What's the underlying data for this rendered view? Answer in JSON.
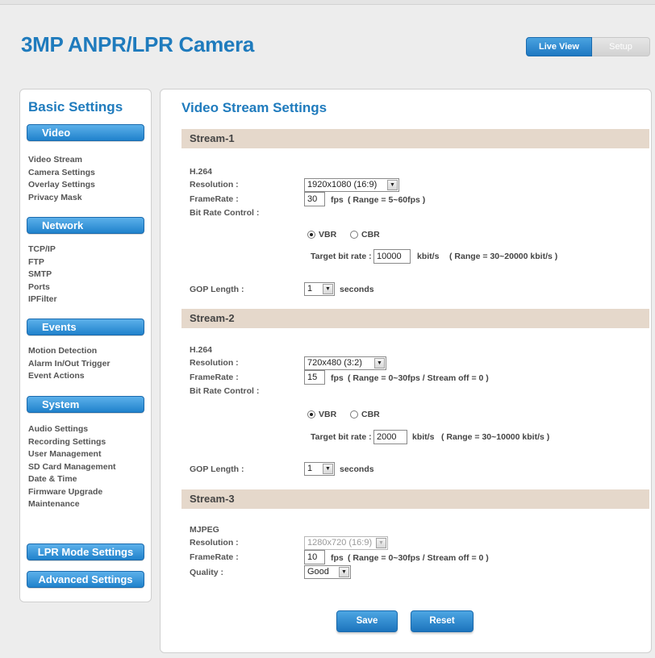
{
  "header": {
    "title": "3MP ANPR/LPR Camera",
    "live_view": "Live View",
    "setup": "Setup"
  },
  "sidebar": {
    "title": "Basic Settings",
    "sections": [
      {
        "label": "Video",
        "items": [
          "Video Stream",
          "Camera Settings",
          "Overlay Settings",
          "Privacy Mask"
        ]
      },
      {
        "label": "Network",
        "items": [
          "TCP/IP",
          "FTP",
          "SMTP",
          "Ports",
          "IPFilter"
        ]
      },
      {
        "label": "Events",
        "items": [
          "Motion Detection",
          "Alarm In/Out Trigger",
          "Event Actions"
        ]
      },
      {
        "label": "System",
        "items": [
          "Audio Settings",
          "Recording Settings",
          "User Management",
          "SD Card Management",
          "Date & Time",
          "Firmware Upgrade",
          "Maintenance"
        ]
      }
    ],
    "lpr_mode": "LPR Mode Settings",
    "advanced": "Advanced Settings"
  },
  "main": {
    "title": "Video Stream Settings",
    "labels": {
      "resolution": "Resolution :",
      "framerate": "FrameRate :",
      "bitrate_control": "Bit Rate Control :",
      "gop": "GOP Length :",
      "quality": "Quality :",
      "vbr": "VBR",
      "cbr": "CBR",
      "target": "Target bit rate :",
      "kbits": "kbit/s",
      "fps": "fps",
      "seconds": "seconds"
    },
    "stream1": {
      "title": "Stream-1",
      "codec": "H.264",
      "resolution": "1920x1080 (16:9)",
      "framerate": "30",
      "fps_range": "( Range = 5~60fps )",
      "bitrate_mode": "VBR",
      "target_bitrate": "10000",
      "bitrate_range": "( Range = 30~20000 kbit/s )",
      "gop": "1"
    },
    "stream2": {
      "title": "Stream-2",
      "codec": "H.264",
      "resolution": "720x480 (3:2)",
      "framerate": "15",
      "fps_range": "( Range = 0~30fps / Stream off = 0 )",
      "bitrate_mode": "VBR",
      "target_bitrate": "2000",
      "bitrate_range": "( Range = 30~10000 kbit/s )",
      "gop": "1"
    },
    "stream3": {
      "title": "Stream-3",
      "codec": "MJPEG",
      "resolution": "1280x720 (16:9)",
      "framerate": "10",
      "fps_range": "( Range = 0~30fps / Stream off = 0 )",
      "quality": "Good"
    },
    "save": "Save",
    "reset": "Reset"
  },
  "colors": {
    "accent": "#1f7bbd",
    "stream_header_bg": "#e5d8cb",
    "page_bg": "#ededed"
  }
}
